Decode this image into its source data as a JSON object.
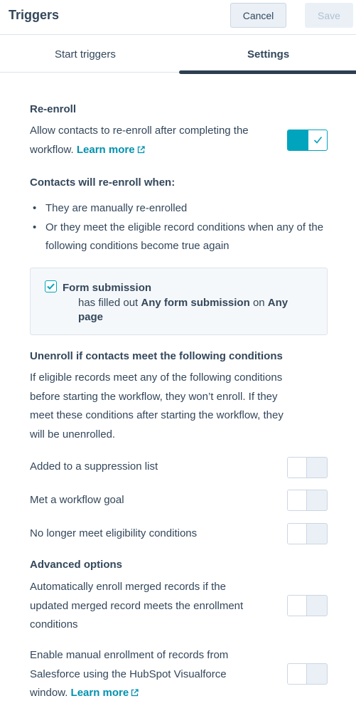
{
  "header": {
    "title": "Triggers",
    "cancel_label": "Cancel",
    "save_label": "Save"
  },
  "tabs": [
    {
      "label": "Start triggers"
    },
    {
      "label": "Settings",
      "active": true
    }
  ],
  "reenroll": {
    "heading": "Re-enroll",
    "desc_line1": "Allow contacts to re-enroll after completing the",
    "desc_line2": "workflow.",
    "learn_more": "Learn more",
    "toggle_on": true
  },
  "reenroll_when": {
    "heading": "Contacts will re-enroll when:",
    "bullets": [
      "They are manually re-enrolled",
      "Or they meet the eligible record conditions when any of the following conditions become true again"
    ]
  },
  "condition_card": {
    "checked": true,
    "title": "Form submission",
    "desc_prefix": "has filled out",
    "desc_form": "Any form submission",
    "desc_mid": "on",
    "desc_page": "Any page"
  },
  "unenroll": {
    "heading": "Unenroll if contacts meet the following conditions",
    "desc_lines": [
      "If eligible records meet any of the following conditions",
      "before starting the workflow, they won’t enroll. If they",
      "meet these conditions after starting the workflow, they",
      "will be unenrolled."
    ],
    "options": [
      {
        "label": "Added to a suppression list",
        "on": false
      },
      {
        "label": "Met a workflow goal",
        "on": false
      },
      {
        "label": "No longer meet eligibility conditions",
        "on": false
      }
    ]
  },
  "advanced": {
    "heading": "Advanced options",
    "merged_lines": [
      "Automatically enroll merged records if the",
      "updated merged record meets the enrollment",
      "conditions"
    ],
    "manual_lines": [
      "Enable manual enrollment of records from",
      "Salesforce using the HubSpot Visualforce",
      "window."
    ],
    "learn_more": "Learn more"
  },
  "colors": {
    "accent": "#00a4bd",
    "link": "#0091ae",
    "text": "#33475b",
    "border": "#cbd6e2"
  },
  "icons": {
    "external_link": "external-link-icon",
    "check": "check-icon",
    "checkbox": "checkbox-checked-icon"
  }
}
